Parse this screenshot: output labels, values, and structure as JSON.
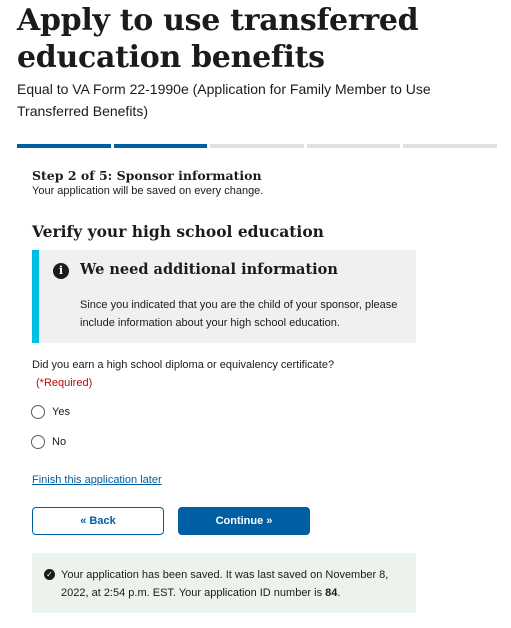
{
  "header": {
    "title": "Apply to use transferred education benefits",
    "subtitle": "Equal to VA Form 22-1990e (Application for Family Member to Use Transferred Benefits)"
  },
  "progress": {
    "current_step": 2,
    "total_steps": 5,
    "completed_color": "#005ea2",
    "remaining_color": "#dfe1e2"
  },
  "step": {
    "title": "Step 2 of 5: Sponsor information",
    "note": "Your application will be saved on every change."
  },
  "section": {
    "heading": "Verify your high school education"
  },
  "alert": {
    "icon": "info-icon",
    "heading": "We need additional information",
    "body": "Since you indicated that you are the child of your sponsor, please include information about your high school education.",
    "accent_color": "#00bde3"
  },
  "question": {
    "label": "Did you earn a high school diploma or equivalency certificate?",
    "required": "(*Required)",
    "options": [
      "Yes",
      "No"
    ]
  },
  "links": {
    "finish_later": "Finish this application later"
  },
  "buttons": {
    "back": "« Back",
    "continue": "Continue »"
  },
  "saved_notice": {
    "icon": "check-circle-icon",
    "text_prefix": "Your application has been saved. It was last saved on November 8, 2022, at 2:54 p.m. EST. Your application ID number is ",
    "application_id": "84",
    "text_suffix": "."
  }
}
